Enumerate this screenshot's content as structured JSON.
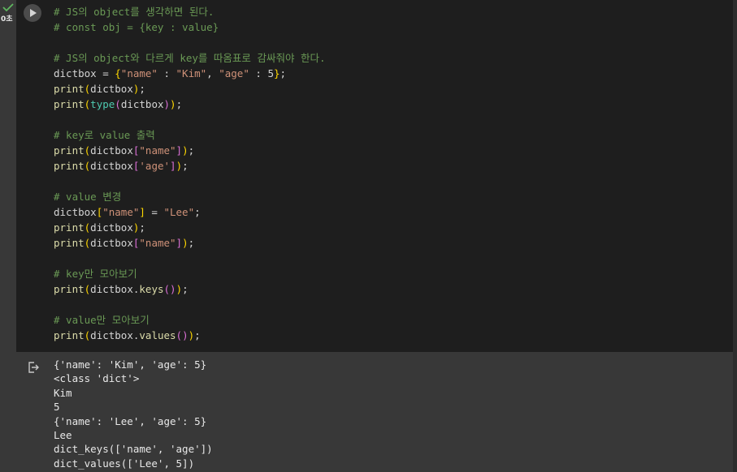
{
  "cell": {
    "status": "check",
    "exec_time": "0초",
    "run_icon": "play-icon",
    "output_icon": "output-redirect-icon",
    "colors": {
      "comment": "#6a9955",
      "string": "#ce9178",
      "function": "#dcdcaa",
      "builtin": "#4ec9b0",
      "bracket1": "#ffd700",
      "bracket2": "#da70d6",
      "code_bg": "#1e1e1e",
      "output_bg": "#383838"
    }
  },
  "code": {
    "c1": "# JS의 object를 생각하면 된다.",
    "c2": "# const obj = {key : value}",
    "c3": "# JS의 object와 다르게 key를 따옴표로 감싸줘야 한다.",
    "l4_a": "dictbox = ",
    "l4_s1": "\"name\"",
    "l4_m1": " : ",
    "l4_s2": "\"Kim\"",
    "l4_m2": ", ",
    "l4_s3": "\"age\"",
    "l4_m3": " : 5",
    "l4_end": ";",
    "l5_arg": "dictbox",
    "l6_fn": "type",
    "l6_arg": "dictbox",
    "c7": "# key로 value 출력",
    "l8_s": "\"name\"",
    "l9_s": "'age'",
    "c10": "# value 변경",
    "l11_s1": "\"name\"",
    "l11_s2": "\"Lee\"",
    "l12_arg": "dictbox",
    "l13_s": "\"name\"",
    "c14": "# key만 모아보기",
    "l15_method": "keys",
    "c16": "# value만 모아보기",
    "l17_method": "values",
    "print": "print",
    "dictbox": "dictbox"
  },
  "output": [
    "{'name': 'Kim', 'age': 5}",
    "<class 'dict'>",
    "Kim",
    "5",
    "{'name': 'Lee', 'age': 5}",
    "Lee",
    "dict_keys(['name', 'age'])",
    "dict_values(['Lee', 5])"
  ]
}
